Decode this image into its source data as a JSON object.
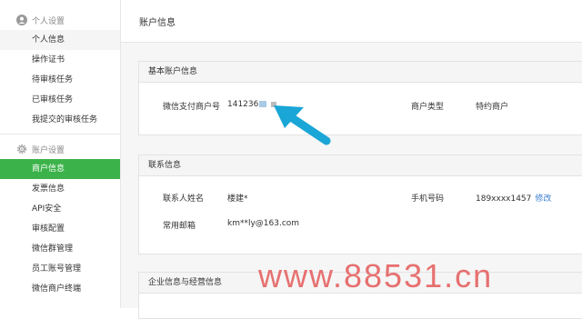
{
  "sidebar": {
    "section_personal": "个人设置",
    "personal_items": [
      "个人信息",
      "操作证书",
      "待审核任务",
      "已审核任务",
      "我提交的审核任务"
    ],
    "section_account": "账户设置",
    "account_items": [
      "商户信息",
      "发票信息",
      "API安全",
      "审核配置",
      "微信群管理",
      "员工账号管理",
      "微信商户终端"
    ],
    "active_item": "商户信息"
  },
  "page": {
    "title": "账户信息"
  },
  "basic": {
    "header": "基本账户信息",
    "merchant_id_label": "微信支付商户号",
    "merchant_id_value": "141236",
    "type_label": "商户类型",
    "type_value": "特约商户"
  },
  "contact": {
    "header": "联系信息",
    "name_label": "联系人姓名",
    "name_value": "楼建*",
    "phone_label": "手机号码",
    "phone_value": "189xxxx1457",
    "modify_link": "修改",
    "email_label": "常用邮箱",
    "email_value": "km**ly@163.com"
  },
  "business": {
    "header": "企业信息与经营信息"
  },
  "watermark": "www.88531.cn",
  "colors": {
    "accent": "#3cb34a",
    "link": "#3c7fd1",
    "arrow": "#1aa6d6",
    "watermark": "#e77070"
  }
}
